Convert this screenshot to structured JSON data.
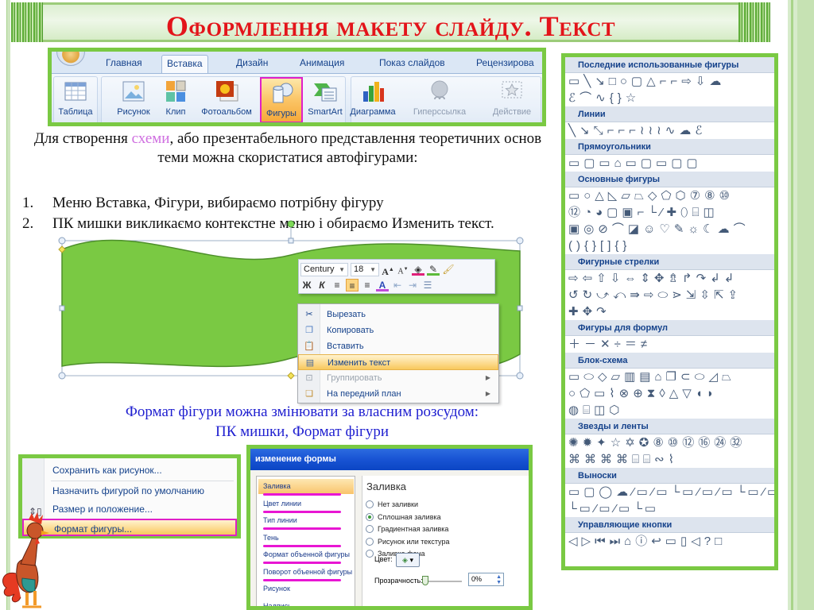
{
  "title": "Оформлення макету слайду. Текст",
  "ribbon": {
    "tabs": [
      {
        "label": "Главная",
        "active": false
      },
      {
        "label": "Вставка",
        "active": true
      },
      {
        "label": "Дизайн",
        "active": false
      },
      {
        "label": "Анимация",
        "active": false
      },
      {
        "label": "Показ слайдов",
        "active": false
      },
      {
        "label": "Рецензирова",
        "active": false
      }
    ],
    "buttons": [
      {
        "label": "Таблица",
        "icon": "table-icon"
      },
      {
        "label": "Рисунок",
        "icon": "picture-icon"
      },
      {
        "label": "Клип",
        "icon": "clipart-icon"
      },
      {
        "label": "Фотоальбом",
        "icon": "photo-album-icon"
      },
      {
        "label": "Фигуры",
        "icon": "shapes-icon",
        "highlighted": true
      },
      {
        "label": "SmartArt",
        "icon": "smartart-icon"
      },
      {
        "label": "Диаграмма",
        "icon": "chart-icon"
      },
      {
        "label": "Гиперссылка",
        "icon": "hyperlink-icon",
        "disabled": true
      },
      {
        "label": "Действие",
        "icon": "action-icon",
        "disabled": true
      }
    ]
  },
  "intro": {
    "before": "Для створення ",
    "accent": "схеми",
    "after": ", або презентабельного представлення теоретичних основ теми можна скористатися автофігурами:",
    "accent_color": "#cf6ee0"
  },
  "steps": [
    {
      "num": "1.",
      "text": "Меню Вставка, Фігури, вибираємо потрібну фігуру"
    },
    {
      "num": "2.",
      "text": "ПК мишки викликаємо контекстне меню і обираємо Изменить текст."
    }
  ],
  "mini_toolbar": {
    "font": "Century",
    "size": "18",
    "row1_icons": [
      "grow-font-icon",
      "shrink-font-icon",
      "fill-color-icon",
      "line-color-icon",
      "format-painter-icon"
    ],
    "row2_icons": [
      "bold-icon",
      "italic-icon",
      "align-left-icon",
      "align-center-icon",
      "align-right-icon",
      "font-color-icon",
      "decrease-indent-icon",
      "increase-indent-icon",
      "bullets-icon"
    ],
    "bold_label": "Ж",
    "italic_label": "К"
  },
  "context_menu": {
    "items": [
      {
        "label": "Вырезать",
        "icon": "scissors-icon"
      },
      {
        "label": "Копировать",
        "icon": "copy-icon"
      },
      {
        "label": "Вставить",
        "icon": "paste-icon"
      },
      {
        "label": "Изменить текст",
        "icon": "edit-text-icon",
        "highlighted": true
      },
      {
        "label": "Группировать",
        "icon": "group-icon",
        "disabled": true,
        "submenu": true
      },
      {
        "label": "На передний план",
        "icon": "bring-front-icon",
        "submenu": true
      }
    ]
  },
  "caption": {
    "line1": "Формат фігури можна змінювати за власним розсудом:",
    "line2": "ПК мишки, Формат фігури",
    "color": "#1f1fd0"
  },
  "gallery": {
    "sections": [
      {
        "title": "Последние использованные фигуры",
        "rows": [
          "▭ ╲ ↘ □ ○ ▢ △ ⌐ ⌐ ⇨ ⇩ ☁",
          "ℰ ⌒ ∿ { } ☆"
        ]
      },
      {
        "title": "Линии",
        "rows": [
          "╲ ↘ ⤡ ⌐ ⌐ ⌐ ≀ ≀ ≀ ∿ ☁ ℰ"
        ]
      },
      {
        "title": "Прямоугольники",
        "rows": [
          "▭ ▢ ▭ ⌂ ▭ ▢ ▭ ▢ ▢"
        ]
      },
      {
        "title": "Основные фигуры",
        "rows": [
          "▭ ○ △ ◺ ▱ ⏢ ◇ ⬠ ⬡ ⑦ ⑧ ⑩",
          "⑫ ◔ ◕ ▢ ▣ ⌐ └ ⁄ ✚ ⬯ ⌸ ◫",
          "▣ ◎ ⊘ ⌒ ◪ ☺ ♡ ✎ ☼ ☾ ☁ ⌒",
          "( ) { } [ ] { }"
        ]
      },
      {
        "title": "Фигурные стрелки",
        "rows": [
          "⇨ ⇦ ⇧ ⇩ ⇔ ⇕ ✥ ⇯ ↱ ↷ ↲ ↲",
          "↺ ↻ ⤻ ⤺ ⇛ ⇨ ⬭ ⋗ ⇲ ⇳ ⇱ ⇪",
          "✚ ✥ ↷"
        ]
      },
      {
        "title": "Фигуры для формул",
        "rows": [
          "＋ － ✕ ÷ ＝ ≠"
        ]
      },
      {
        "title": "Блок-схема",
        "rows": [
          "▭ ⬭ ◇ ▱ ▥ ▤ ⌂ ❐ ⊂ ⬭ ◿ ⏢",
          "○ ⬠ ▭ ⌇ ⊗ ⊕ ⧗ ◊ △ ▽ ◖ ◗",
          "◍ ⌸ ◫ ⬡"
        ]
      },
      {
        "title": "Звезды и ленты",
        "rows": [
          "✺ ✹ ✦ ☆ ✡ ✪ ⑧ ⑩ ⑫ ⑯ ㉔ ㉜",
          "⌘ ⌘ ⌘ ⌘ ⌸ ⌸ ∾ ⌇"
        ]
      },
      {
        "title": "Выноски",
        "rows": [
          "▭ ▢ ◯ ☁ ⁄▭ ⁄▭ └▭ ⁄▭ ⁄▭ └▭ ⁄▭ ⁄▭",
          "└▭ ⁄▭ ⁄▭ └▭"
        ]
      },
      {
        "title": "Управляющие кнопки",
        "rows": [
          "◁ ▷ ⏮ ⏭ ⌂ ⓘ ↩ ▭ ▯ ◁ ? □"
        ]
      }
    ]
  },
  "shape_menu": {
    "items": [
      {
        "label": "Сохранить как рисунок...",
        "icon": ""
      },
      {
        "label": "Назначить фигурой по умолчанию",
        "icon": ""
      },
      {
        "label": "Размер и положение...",
        "icon": "size-position-icon"
      },
      {
        "label": "Формат фигуры...",
        "icon": "",
        "highlighted": true
      }
    ]
  },
  "format_dialog": {
    "title": "изменение формы",
    "nav": [
      {
        "label": "Заливка",
        "active": true,
        "underlined": true
      },
      {
        "label": "Цвет линии",
        "underlined": true
      },
      {
        "label": "Тип линии",
        "underlined": true
      },
      {
        "label": "Тень",
        "underlined": true
      },
      {
        "label": "Формат объенной фигуры",
        "underlined": true
      },
      {
        "label": "Поворот объенной фигуры",
        "underlined": true
      },
      {
        "label": "Рисунок"
      },
      {
        "label": "Надпись"
      }
    ],
    "section_title": "Заливка",
    "options": [
      {
        "label": "Нет заливки",
        "checked": false
      },
      {
        "label": "Сплошная заливка",
        "checked": true
      },
      {
        "label": "Градиентная заливка",
        "checked": false
      },
      {
        "label": "Рисунок или текстура",
        "checked": false
      },
      {
        "label": "Заливка фона",
        "checked": false
      }
    ],
    "color_label": "Цвет:",
    "transparency_label": "Прозрачность:",
    "transparency_value": "0%",
    "transparency_fraction": 0
  },
  "colors": {
    "frame_green": "#7ac943",
    "title_red": "#e3141a",
    "highlight_magenta": "#e020c8",
    "shape_fill": "#7ac943"
  }
}
